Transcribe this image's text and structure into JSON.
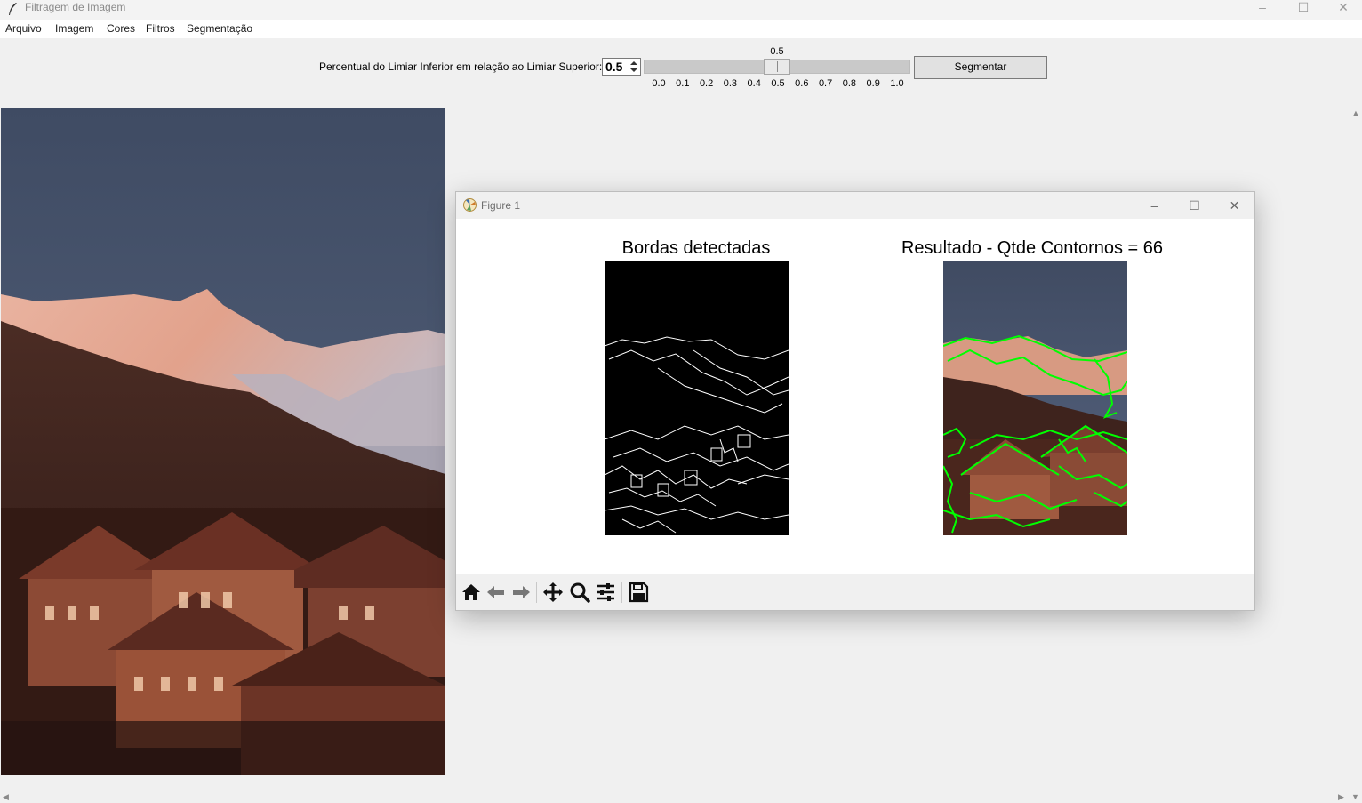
{
  "window": {
    "title": "Filtragem de Imagem",
    "controls": {
      "minimize": "–",
      "maximize": "☐",
      "close": "✕"
    }
  },
  "menubar": {
    "items": [
      "Arquivo",
      "Imagem",
      "Cores",
      "Filtros",
      "Segmentação"
    ]
  },
  "controls": {
    "threshold_label": "Percentual do Limiar Inferior em relação ao Limiar Superior:",
    "spin_value": "0.5",
    "slider": {
      "value": 0.5,
      "value_label": "0.5",
      "min": 0.0,
      "max": 1.0,
      "ticks": [
        "0.0",
        "0.1",
        "0.2",
        "0.3",
        "0.4",
        "0.5",
        "0.6",
        "0.7",
        "0.8",
        "0.9",
        "1.0"
      ]
    },
    "segment_button": "Segmentar"
  },
  "figure": {
    "title": "Figure 1",
    "controls": {
      "minimize": "–",
      "maximize": "☐",
      "close": "✕"
    },
    "subplots": [
      {
        "title": "Bordas detectadas"
      },
      {
        "title": "Resultado - Qtde Contornos = 66"
      }
    ],
    "toolbar": [
      "home-icon",
      "back-icon",
      "forward-icon",
      "pan-icon",
      "zoom-icon",
      "configure-subplots-icon",
      "save-icon"
    ]
  },
  "colors": {
    "contour": "#00ff00",
    "sky": "#4a5670",
    "peak": "#e0a08a",
    "roof": "#5a2a20"
  }
}
